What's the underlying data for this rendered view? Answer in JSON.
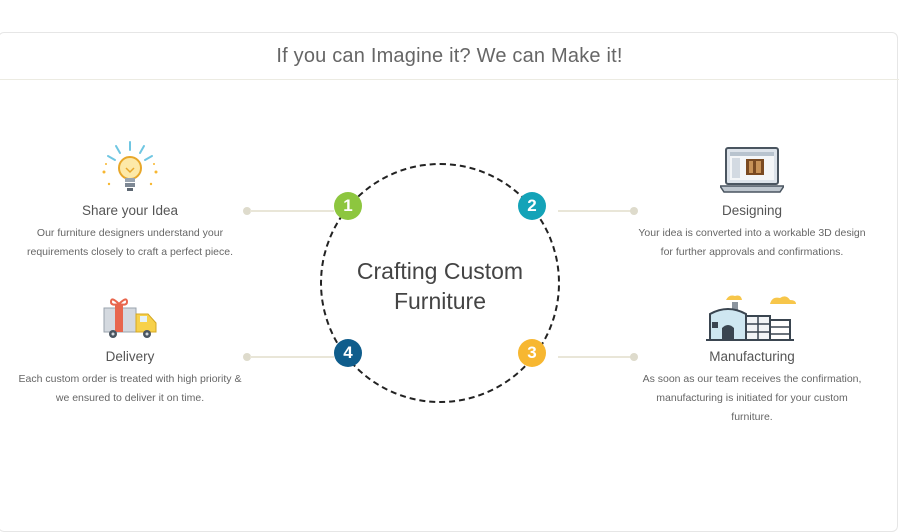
{
  "header": {
    "title": "If you can Imagine it? We can Make it!"
  },
  "center": {
    "line1": "Crafting Custom",
    "line2": "Furniture"
  },
  "steps": [
    {
      "number": "1",
      "title": "Share your Idea",
      "desc_line1": "Our furniture designers understand your",
      "desc_line2": "requirements closely to craft a perfect piece.",
      "color": "#8dc63f",
      "icon": "lightbulb-icon"
    },
    {
      "number": "2",
      "title": "Designing",
      "desc_line1": "Your idea is converted into a workable 3D design",
      "desc_line2": "for further approvals and confirmations.",
      "color": "#14a3b8",
      "icon": "laptop-icon"
    },
    {
      "number": "3",
      "title": "Manufacturing",
      "desc_line1": "As soon as our team receives the confirmation,",
      "desc_line2": "manufacturing is initiated for your custom",
      "desc_line3": "furniture.",
      "color": "#f7b731",
      "icon": "factory-icon"
    },
    {
      "number": "4",
      "title": "Delivery",
      "desc_line1": "Each custom order is treated with high priority &",
      "desc_line2": "we ensured to deliver it on time.",
      "color": "#0f5d8c",
      "icon": "delivery-truck-icon"
    }
  ]
}
